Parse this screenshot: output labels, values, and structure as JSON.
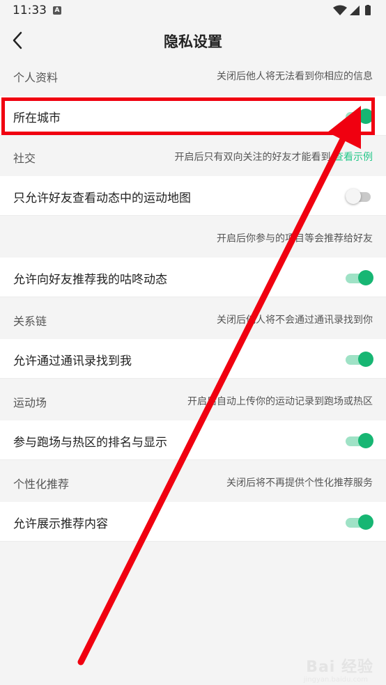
{
  "status_bar": {
    "time": "11:33",
    "notif": "A"
  },
  "nav": {
    "title": "隐私设置"
  },
  "sections": [
    {
      "title": "个人资料",
      "hint": "关闭后他人将无法看到你相应的信息"
    },
    {
      "title": "社交",
      "hint": "开启后只有双向关注的好友才能看到",
      "link": "查看示例"
    },
    {
      "title": "",
      "hint": "开启后你参与的项目等会推荐给好友"
    },
    {
      "title": "关系链",
      "hint": "关闭后他人将不会通过通讯录找到你"
    },
    {
      "title": "运动场",
      "hint": "开启后自动上传你的运动记录到跑场或热区"
    },
    {
      "title": "个性化推荐",
      "hint": "关闭后将不再提供个性化推荐服务"
    }
  ],
  "rows": [
    {
      "label": "所在城市",
      "on": true
    },
    {
      "label": "只允许好友查看动态中的运动地图",
      "on": false
    },
    {
      "label": "允许向好友推荐我的咕咚动态",
      "on": true
    },
    {
      "label": "允许通过通讯录找到我",
      "on": true
    },
    {
      "label": "参与跑场与热区的排名与显示",
      "on": true
    },
    {
      "label": "允许展示推荐内容",
      "on": true
    }
  ],
  "colors": {
    "accent": "#17b673",
    "annotation": "#f00010"
  },
  "watermark": {
    "text": "Bai 经验",
    "sub": "jingyan.baidu.com"
  }
}
